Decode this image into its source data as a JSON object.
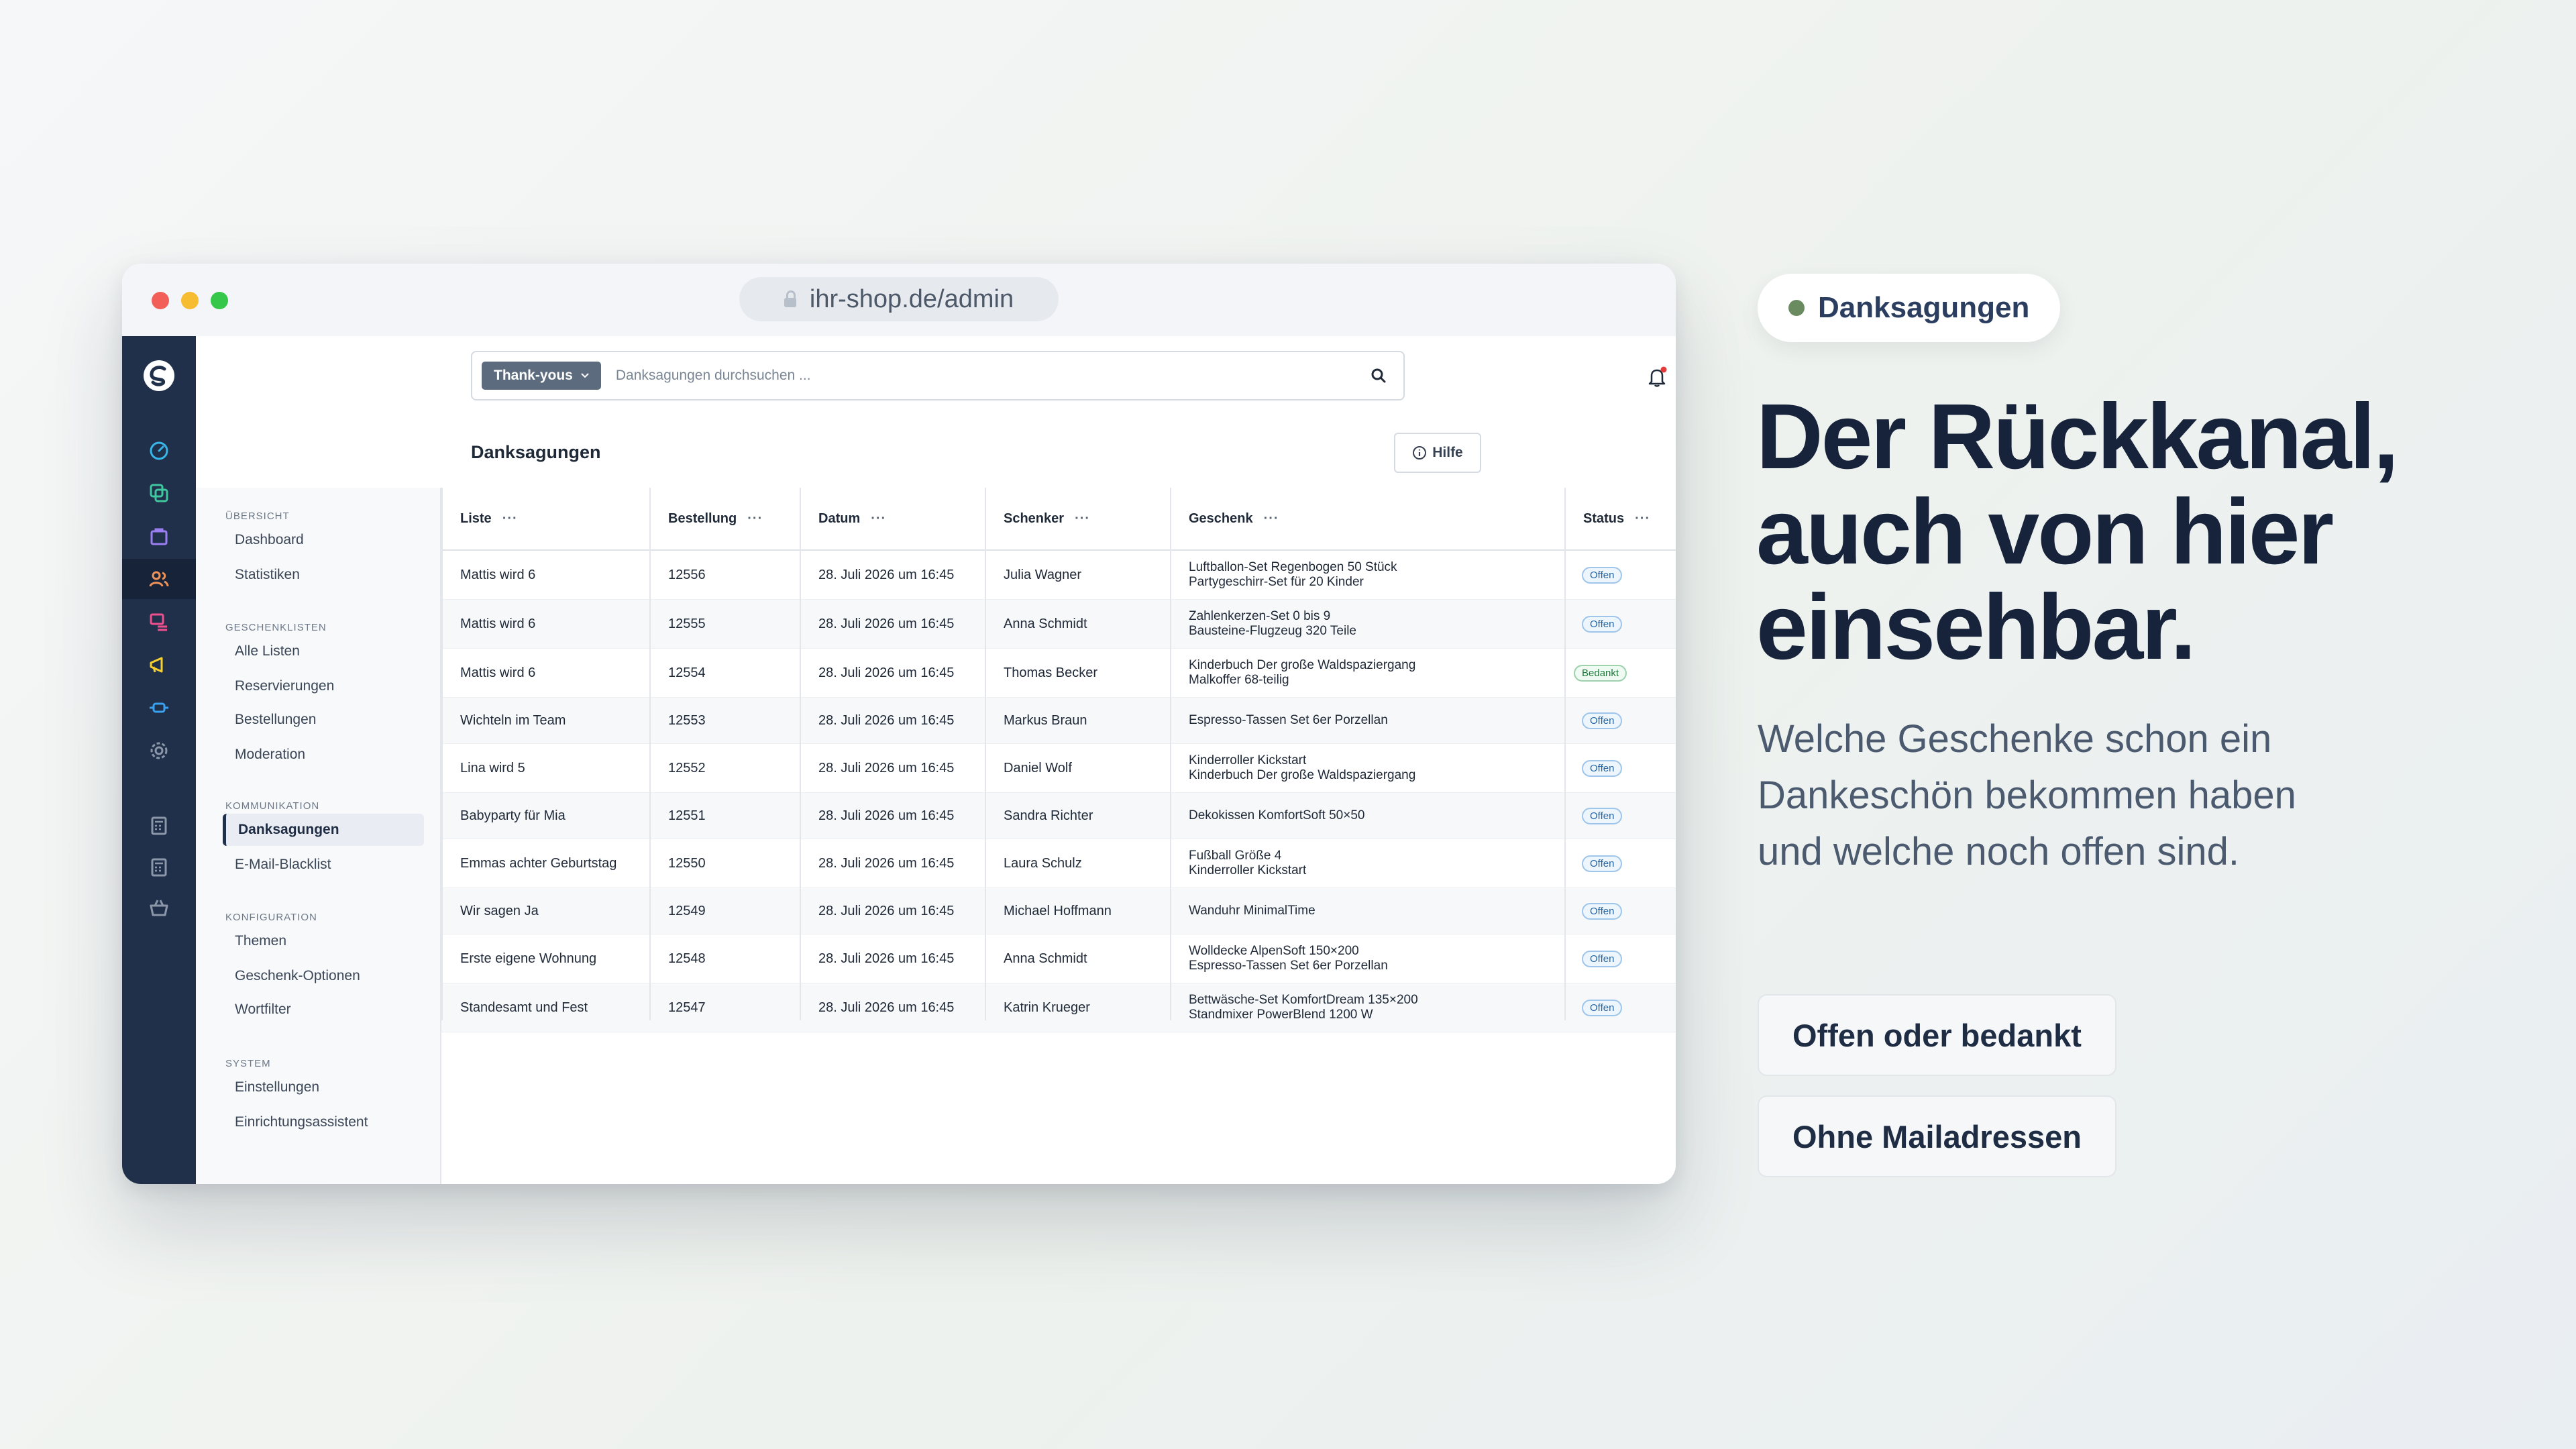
{
  "browser": {
    "url": "ihr-shop.de/admin"
  },
  "search": {
    "scope_chip": "Thank-yous",
    "placeholder": "Danksagungen durchsuchen ..."
  },
  "header": {
    "title": "Danksagungen",
    "help_label": "Hilfe"
  },
  "subnav": {
    "sections": [
      {
        "title": "ÜBERSICHT",
        "items": [
          "Dashboard",
          "Statistiken"
        ]
      },
      {
        "title": "GESCHENKLISTEN",
        "items": [
          "Alle Listen",
          "Reservierungen",
          "Bestellungen",
          "Moderation"
        ]
      },
      {
        "title": "KOMMUNIKATION",
        "items": [
          "Danksagungen",
          "E-Mail-Blacklist"
        ]
      },
      {
        "title": "KONFIGURATION",
        "items": [
          "Themen",
          "Geschenk-Optionen",
          "Wortfilter"
        ]
      },
      {
        "title": "SYSTEM",
        "items": [
          "Einstellungen",
          "Einrichtungsassistent"
        ]
      }
    ],
    "active_item": "Danksagungen"
  },
  "table": {
    "columns": [
      "Liste",
      "Bestellung",
      "Datum",
      "Schenker",
      "Geschenk",
      "Status"
    ],
    "column_menu": "···",
    "row_menu": "···",
    "rows": [
      {
        "liste": "Mattis wird 6",
        "bestellung": "12556",
        "datum": "28. Juli 2026 um 16:45",
        "schenker": "Julia Wagner",
        "geschenk": [
          "Luftballon-Set Regenbogen 50 Stück",
          "Partygeschirr-Set für 20 Kinder"
        ],
        "status": "Offen"
      },
      {
        "liste": "Mattis wird 6",
        "bestellung": "12555",
        "datum": "28. Juli 2026 um 16:45",
        "schenker": "Anna Schmidt",
        "geschenk": [
          "Zahlenkerzen-Set 0 bis 9",
          "Bausteine-Flugzeug 320 Teile"
        ],
        "status": "Offen"
      },
      {
        "liste": "Mattis wird 6",
        "bestellung": "12554",
        "datum": "28. Juli 2026 um 16:45",
        "schenker": "Thomas Becker",
        "geschenk": [
          "Kinderbuch Der große Waldspaziergang",
          "Malkoffer 68-teilig"
        ],
        "status": "Bedankt"
      },
      {
        "liste": "Wichteln im Team",
        "bestellung": "12553",
        "datum": "28. Juli 2026 um 16:45",
        "schenker": "Markus Braun",
        "geschenk": [
          "Espresso-Tassen Set 6er Porzellan"
        ],
        "status": "Offen"
      },
      {
        "liste": "Lina wird 5",
        "bestellung": "12552",
        "datum": "28. Juli 2026 um 16:45",
        "schenker": "Daniel Wolf",
        "geschenk": [
          "Kinderroller Kickstart",
          "Kinderbuch Der große Waldspaziergang"
        ],
        "status": "Offen"
      },
      {
        "liste": "Babyparty für Mia",
        "bestellung": "12551",
        "datum": "28. Juli 2026 um 16:45",
        "schenker": "Sandra Richter",
        "geschenk": [
          "Dekokissen KomfortSoft 50×50"
        ],
        "status": "Offen"
      },
      {
        "liste": "Emmas achter Geburtstag",
        "bestellung": "12550",
        "datum": "28. Juli 2026 um 16:45",
        "schenker": "Laura Schulz",
        "geschenk": [
          "Fußball Größe 4",
          "Kinderroller Kickstart"
        ],
        "status": "Offen"
      },
      {
        "liste": "Wir sagen Ja",
        "bestellung": "12549",
        "datum": "28. Juli 2026 um 16:45",
        "schenker": "Michael Hoffmann",
        "geschenk": [
          "Wanduhr MinimalTime"
        ],
        "status": "Offen"
      },
      {
        "liste": "Erste eigene Wohnung",
        "bestellung": "12548",
        "datum": "28. Juli 2026 um 16:45",
        "schenker": "Anna Schmidt",
        "geschenk": [
          "Wolldecke AlpenSoft 150×200",
          "Espresso-Tassen Set 6er Porzellan"
        ],
        "status": "Offen"
      },
      {
        "liste": "Standesamt und Fest",
        "bestellung": "12547",
        "datum": "28. Juli 2026 um 16:45",
        "schenker": "Katrin Krueger",
        "geschenk": [
          "Bettwäsche-Set KomfortDream 135×200",
          "Standmixer PowerBlend 1200 W"
        ],
        "status": "Offen"
      }
    ]
  },
  "promo": {
    "tag": "Danksagungen",
    "headline": [
      "Der Rückkanal,",
      "auch von hier",
      "einsehbar."
    ],
    "lead": "Welche Geschenke schon ein Dankeschön bekommen haben und welche noch offen sind.",
    "buttons": [
      "Offen oder bedankt",
      "Ohne Mailadressen"
    ]
  },
  "colors": {
    "rail": "#20304a",
    "accent_green": "#6a8a5f",
    "status_open": "#2466a8",
    "status_thanked": "#1d7a3b"
  },
  "icons": [
    "brand-logo-icon",
    "dashboard-icon",
    "copy-icon",
    "bag-icon",
    "users-icon",
    "list-icon",
    "megaphone-icon",
    "plugin-icon",
    "gear-icon",
    "calculator-icon",
    "basket-icon",
    "search-icon",
    "bell-icon",
    "info-icon",
    "columns-icon"
  ]
}
